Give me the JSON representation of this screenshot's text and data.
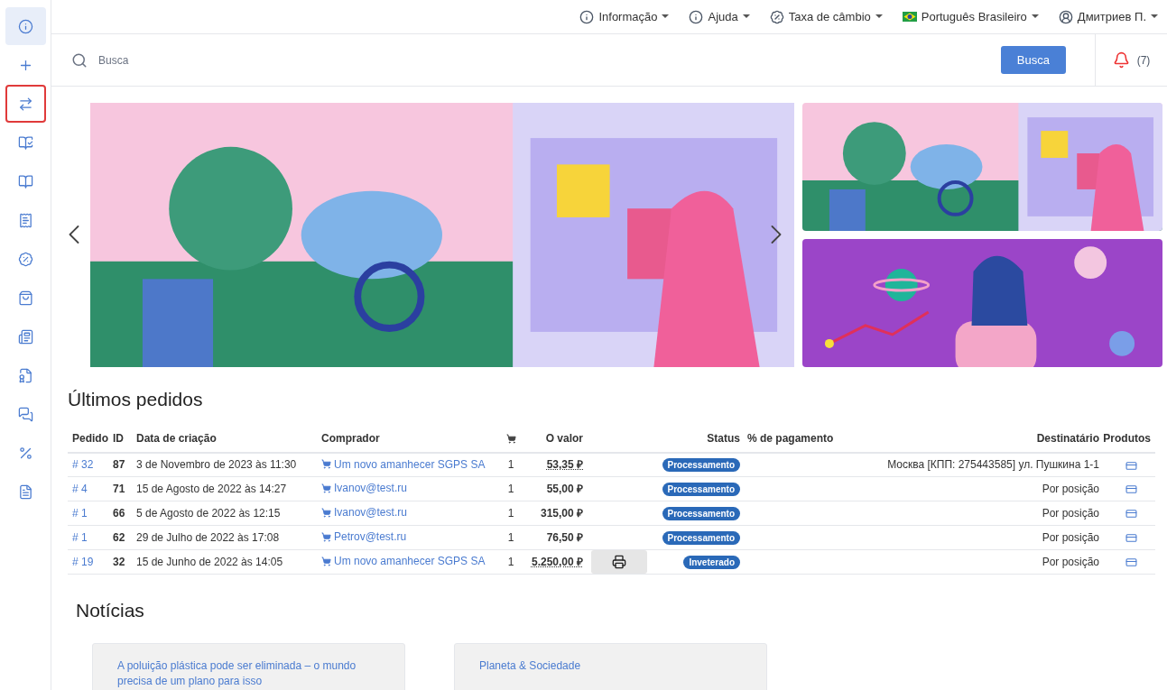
{
  "sidebar": {
    "items": [
      {
        "selected": true,
        "outlined": false
      },
      {
        "selected": false,
        "outlined": false
      },
      {
        "selected": false,
        "outlined": true
      },
      {
        "selected": false,
        "outlined": false
      },
      {
        "selected": false,
        "outlined": false
      },
      {
        "selected": false,
        "outlined": false
      },
      {
        "selected": false,
        "outlined": false
      },
      {
        "selected": false,
        "outlined": false
      },
      {
        "selected": false,
        "outlined": false
      },
      {
        "selected": false,
        "outlined": false
      },
      {
        "selected": false,
        "outlined": false
      },
      {
        "selected": false,
        "outlined": false
      },
      {
        "selected": false,
        "outlined": false
      }
    ]
  },
  "top_menu": [
    {
      "kind": "info",
      "label": "Informação"
    },
    {
      "kind": "info",
      "label": "Ajuda"
    },
    {
      "kind": "percent",
      "label": "Taxa de câmbio"
    },
    {
      "kind": "flag",
      "label": "Português Brasileiro"
    },
    {
      "kind": "user",
      "label": "Дмитриев П."
    }
  ],
  "search": {
    "placeholder": "Busca",
    "button": "Busca"
  },
  "notifications": {
    "count": "(7)"
  },
  "orders": {
    "title": "Últimos pedidos",
    "columns": [
      "Pedido",
      "ID",
      "Data de criação",
      "Comprador",
      "O valor",
      "Status",
      "% de pagamento",
      "Destinatário",
      "Produtos"
    ],
    "rows": [
      {
        "order": "# 32",
        "id": "87",
        "date": "3 de Novembro de 2023 às 11:30",
        "buyer": "Um novo amanhecer SGPS SA",
        "qty": "1",
        "value": "53,35 ₽",
        "dotted": true,
        "print": false,
        "status": "Processamento",
        "recipient": "Москва [КПП: 275443585] ул. Пушкина 1-1"
      },
      {
        "order": "# 4",
        "id": "71",
        "date": "15 de Agosto de 2022 às 14:27",
        "buyer": "Ivanov@test.ru",
        "qty": "1",
        "value": "55,00 ₽",
        "dotted": false,
        "print": false,
        "status": "Processamento",
        "recipient": "Por posição"
      },
      {
        "order": "# 1",
        "id": "66",
        "date": "5 de Agosto de 2022 às 12:15",
        "buyer": "Ivanov@test.ru",
        "qty": "1",
        "value": "315,00 ₽",
        "dotted": false,
        "print": false,
        "status": "Processamento",
        "recipient": "Por posição"
      },
      {
        "order": "# 1",
        "id": "62",
        "date": "29 de Julho de 2022 às 17:08",
        "buyer": "Petrov@test.ru",
        "qty": "1",
        "value": "76,50 ₽",
        "dotted": false,
        "print": false,
        "status": "Processamento",
        "recipient": "Por posição"
      },
      {
        "order": "# 19",
        "id": "32",
        "date": "15 de Junho de 2022 às 14:05",
        "buyer": "Um novo amanhecer SGPS SA",
        "qty": "1",
        "value": "5.250,00 ₽",
        "dotted": true,
        "print": true,
        "status": "Inveterado",
        "recipient": "Por posição"
      }
    ]
  },
  "news": {
    "title": "Notícias",
    "items": [
      "A poluição plástica pode ser eliminada – o mundo precisa de um plano para isso",
      "Planeta & Sociedade"
    ]
  }
}
